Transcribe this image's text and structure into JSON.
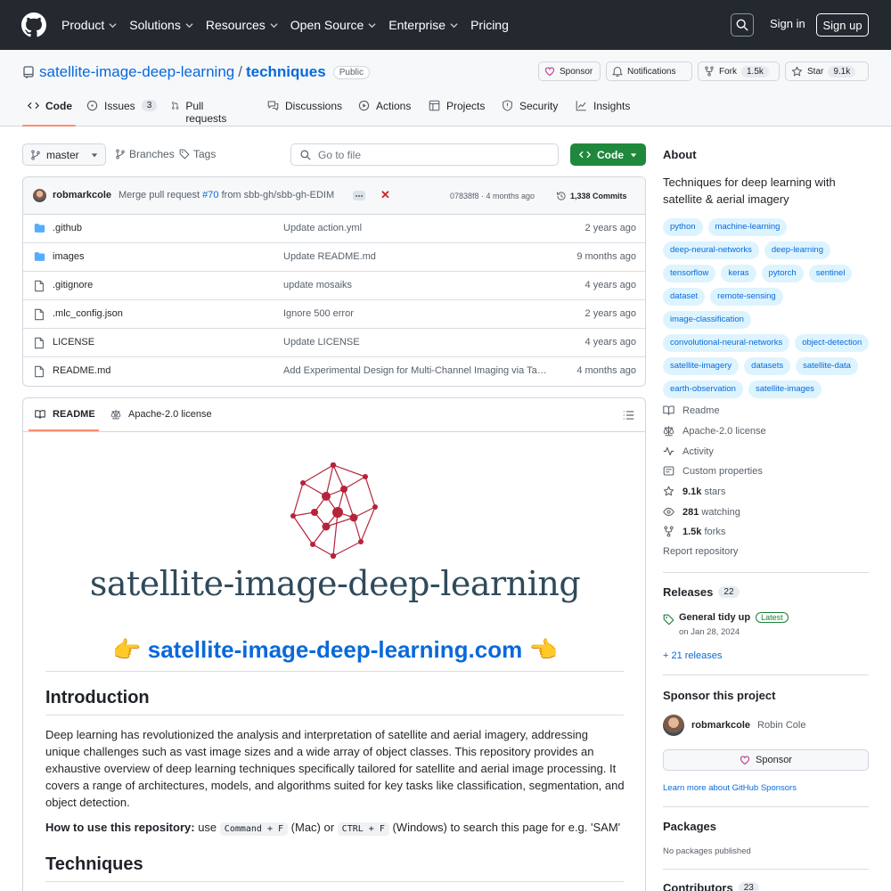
{
  "header": {
    "nav": [
      "Product",
      "Solutions",
      "Resources",
      "Open Source",
      "Enterprise",
      "Pricing"
    ],
    "sign_in": "Sign in",
    "sign_up": "Sign up"
  },
  "repo": {
    "owner": "satellite-image-deep-learning",
    "separator": "/",
    "name": "techniques",
    "visibility": "Public",
    "sponsor": "Sponsor",
    "notifications": "Notifications",
    "fork": "Fork",
    "fork_count": "1.5k",
    "star": "Star",
    "star_count": "9.1k"
  },
  "tabs": [
    {
      "label": "Code"
    },
    {
      "label": "Issues",
      "count": "3"
    },
    {
      "label": "Pull requests"
    },
    {
      "label": "Discussions"
    },
    {
      "label": "Actions"
    },
    {
      "label": "Projects"
    },
    {
      "label": "Security"
    },
    {
      "label": "Insights"
    }
  ],
  "browser": {
    "branch": "master",
    "branches": "Branches",
    "tags": "Tags",
    "goto_placeholder": "Go to file",
    "code_button": "Code"
  },
  "commit": {
    "author": "robmarkcole",
    "message_prefix": "Merge pull request",
    "pr": "#70",
    "message_suffix": "from sbb-gh/sbb-gh-EDIM",
    "hash_time": "07838f8 · 4 months ago",
    "commits": "1,338 Commits"
  },
  "files": [
    {
      "name": ".github",
      "type": "folder",
      "message": "Update action.yml",
      "time": "2 years ago"
    },
    {
      "name": "images",
      "type": "folder",
      "message": "Update README.md",
      "time": "9 months ago"
    },
    {
      "name": ".gitignore",
      "type": "file",
      "message": "update mosaiks",
      "time": "4 years ago"
    },
    {
      "name": ".mlc_config.json",
      "type": "file",
      "message": "Ignore 500 error",
      "time": "2 years ago"
    },
    {
      "name": "LICENSE",
      "type": "file",
      "message": "Update LICENSE",
      "time": "4 years ago"
    },
    {
      "name": "README.md",
      "type": "file",
      "message": "Add Experimental Design for Multi-Channel Imaging via Task-Driven Feature Selection",
      "time": "4 months ago"
    }
  ],
  "readme": {
    "tab_readme": "README",
    "tab_license": "Apache-2.0 license",
    "logo_text": "satellite-image-deep-learning",
    "emoji_left": "👉",
    "site_link": "satellite-image-deep-learning.com",
    "emoji_right": "👈",
    "intro_heading": "Introduction",
    "intro_text": "Deep learning has revolutionized the analysis and interpretation of satellite and aerial imagery, addressing unique challenges such as vast image sizes and a wide array of object classes. This repository provides an exhaustive overview of deep learning techniques specifically tailored for satellite and aerial image processing. It covers a range of architectures, models, and algorithms suited for key tasks like classification, segmentation, and object detection.",
    "howto_bold": "How to use this repository:",
    "howto_use": "use",
    "howto_kbd1": "Command + F",
    "howto_mac": "(Mac) or",
    "howto_kbd2": "CTRL + F",
    "howto_rest": "(Windows) to search this page for e.g. 'SAM'",
    "tech_heading": "Techniques"
  },
  "about": {
    "heading": "About",
    "description": "Techniques for deep learning with satellite & aerial imagery",
    "topics": [
      "python",
      "machine-learning",
      "deep-neural-networks",
      "deep-learning",
      "tensorflow",
      "keras",
      "pytorch",
      "sentinel",
      "dataset",
      "remote-sensing",
      "image-classification",
      "convolutional-neural-networks",
      "object-detection",
      "satellite-imagery",
      "datasets",
      "satellite-data",
      "earth-observation",
      "satellite-images"
    ],
    "readme": "Readme",
    "license": "Apache-2.0 license",
    "activity": "Activity",
    "custom_properties": "Custom properties",
    "stars_count": "9.1k",
    "stars_label": "stars",
    "watching_count": "281",
    "watching_label": "watching",
    "forks_count": "1.5k",
    "forks_label": "forks",
    "report": "Report repository"
  },
  "releases": {
    "heading": "Releases",
    "count": "22",
    "latest_name": "General tidy up",
    "latest_badge": "Latest",
    "latest_date": "on Jan 28, 2024",
    "more": "+ 21 releases"
  },
  "sponsor": {
    "heading": "Sponsor this project",
    "user": "robmarkcole",
    "real_name": "Robin Cole",
    "button": "Sponsor",
    "learn_more": "Learn more about GitHub Sponsors"
  },
  "packages": {
    "heading": "Packages",
    "none": "No packages published"
  },
  "contributors": {
    "heading": "Contributors",
    "count": "23"
  },
  "colors": {
    "header_bg": "#24292f",
    "link": "#0969da",
    "green": "#1f883d",
    "tab_accent": "#fd8c73",
    "logo_red": "#b5243b"
  }
}
